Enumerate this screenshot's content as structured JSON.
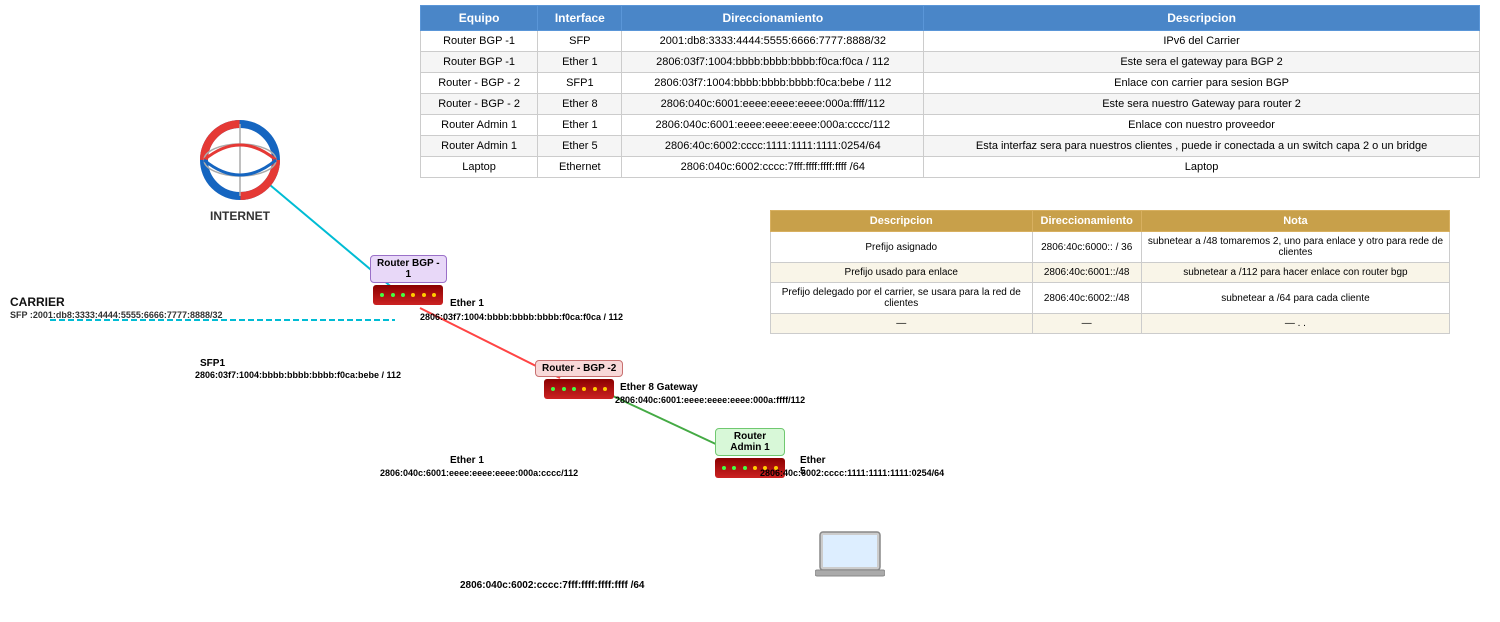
{
  "table": {
    "headers": [
      "Equipo",
      "Interface",
      "Direccionamiento",
      "Descripcion"
    ],
    "rows": [
      [
        "Router BGP -1",
        "SFP",
        "2001:db8:3333:4444:5555:6666:7777:8888/32",
        "IPv6 del Carrier"
      ],
      [
        "Router BGP -1",
        "Ether 1",
        "2806:03f7:1004:bbbb:bbbb:bbbb:f0ca:f0ca / 112",
        "Este sera el gateway para BGP 2"
      ],
      [
        "Router - BGP - 2",
        "SFP1",
        "2806:03f7:1004:bbbb:bbbb:bbbb:f0ca:bebe / 112",
        "Enlace con carrier para sesion BGP"
      ],
      [
        "Router - BGP - 2",
        "Ether 8",
        "2806:040c:6001:eeee:eeee:eeee:000a:ffff/112",
        "Este sera nuestro Gateway para router 2"
      ],
      [
        "Router Admin 1",
        "Ether 1",
        "2806:040c:6001:eeee:eeee:eeee:000a:cccc/112",
        "Enlace con nuestro proveedor"
      ],
      [
        "Router Admin 1",
        "Ether 5",
        "2806:40c:6002:cccc:1111:1111:1111:0254/64",
        "Esta interfaz sera para nuestros clientes , puede ir conectada a un switch capa 2 o un bridge"
      ],
      [
        "Laptop",
        "Ethernet",
        "2806:040c:6002:cccc:7fff:ffff:ffff:ffff /64",
        "Laptop"
      ]
    ]
  },
  "sec_table": {
    "headers": [
      "Descripcion",
      "Direccionamiento",
      "Nota"
    ],
    "rows": [
      [
        "Prefijo asignado",
        "2806:40c:6000:: / 36",
        "subnetear a /48  tomaremos 2, uno para enlace y otro para rede de clientes"
      ],
      [
        "Prefijo usado para enlace",
        "2806:40c:6001::/48",
        "subnetear a /112 para hacer enlace con router bgp"
      ],
      [
        "Prefijo delegado por el carrier, se usara para la red de clientes",
        "2806:40c:6002::/48",
        "subnetear a /64 para cada cliente"
      ],
      [
        "—",
        "—",
        "— .  ."
      ]
    ]
  },
  "diagram": {
    "internet_label": "INTERNET",
    "carrier_label": "CARRIER",
    "carrier_sfp": "SFP :2001:db8:3333:4444:5555:6666:7777:8888/32",
    "router_bgp1_label": "Router BGP -\n1",
    "router_bgp2_label": "Router - BGP -2",
    "router_admin1_label": "Router Admin 1",
    "ether1_bgp1": "Ether 1",
    "addr_ether1_bgp1": "2806:03f7:1004:bbbb:bbbb:bbbb:f0ca:f0ca / 112",
    "sfp1_bgp2": "SFP1",
    "addr_sfp1_bgp2": "2806:03f7:1004:bbbb:bbbb:bbbb:f0ca:bebe / 112",
    "ether8_gw": "Ether 8 Gateway",
    "addr_ether8": "2806:040c:6001:eeee:eeee:eeee:000a:ffff/112",
    "ether1_admin": "Ether 1",
    "addr_ether1_admin": "2806:040c:6001:eeee:eeee:eeee:000a:cccc/112",
    "ether5_admin": "Ether 5",
    "addr_ether5_admin": "2806:40c:6002:cccc:1111:1111:1111:0254/64",
    "laptop_addr": "2806:040c:6002:cccc:7fff:ffff:ffff:ffff /64",
    "laptop_label": "Laptop"
  }
}
